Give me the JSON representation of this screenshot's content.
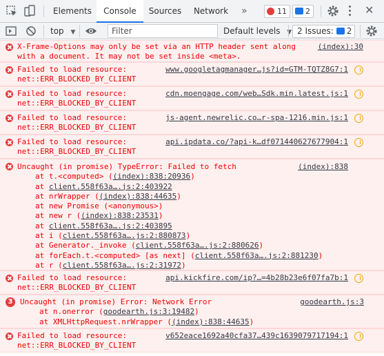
{
  "tabs": [
    {
      "label": "Elements"
    },
    {
      "label": "Console"
    },
    {
      "label": "Sources"
    },
    {
      "label": "Network"
    }
  ],
  "badges": {
    "errors": "11",
    "messages": "2"
  },
  "filterbar": {
    "context": "top",
    "filter_placeholder": "Filter",
    "levels": "Default levels",
    "issues_label": "2 Issues:",
    "issues_count": "2"
  },
  "colors": {
    "error_text": "#e00000",
    "error_bg": "#fff0f0",
    "accent": "#1a73e8",
    "warn": "#f0a500"
  },
  "messages": [
    {
      "lines": [
        "X-Frame-Options may only be set via an HTTP header sent along",
        "with a document. It may not be set inside <meta>."
      ],
      "source": "(index):30"
    },
    {
      "lines": [
        "Failed to load resource:",
        "net::ERR_BLOCKED_BY_CLIENT"
      ],
      "source": "www.googletagmanager…js?id=GTM-TQTZ8G7:1"
    },
    {
      "lines": [
        "Failed to load resource:",
        "net::ERR_BLOCKED_BY_CLIENT"
      ],
      "source": "cdn.moengage.com/web…Sdk.min.latest.js:1"
    },
    {
      "lines": [
        "Failed to load resource:",
        "net::ERR_BLOCKED_BY_CLIENT"
      ],
      "source": "js-agent.newrelic.co…r-spa-1216.min.js:1"
    },
    {
      "lines": [
        "Failed to load resource:",
        "net::ERR_BLOCKED_BY_CLIENT"
      ],
      "source": "api.ipdata.co/?api-k…df071440627677904:1"
    },
    {
      "head": "Uncaught (in promise) TypeError: Failed to fetch",
      "source": "(index):838",
      "stack": [
        {
          "pre": "at t.<computed> (",
          "link": "(index):838:20936",
          "post": ")"
        },
        {
          "pre": "at ",
          "link": "client.558f63a….js:2:403922",
          "post": ""
        },
        {
          "pre": "at nrWrapper (",
          "link": "(index):838:44635",
          "post": ")"
        },
        {
          "pre": "at new Promise (<anonymous>)",
          "link": "",
          "post": ""
        },
        {
          "pre": "at new r (",
          "link": "(index):838:23531",
          "post": ")"
        },
        {
          "pre": "at ",
          "link": "client.558f63a….js:2:403895",
          "post": ""
        },
        {
          "pre": "at i (",
          "link": "client.558f63a….js:2:880873",
          "post": ")"
        },
        {
          "pre": "at Generator._invoke (",
          "link": "client.558f63a….js:2:880626",
          "post": ")"
        },
        {
          "pre": "at forEach.t.<computed> [as next] (",
          "link": "client.558f63a….js:2:881230",
          "post": ")"
        },
        {
          "pre": "at r (",
          "link": "client.558f63a….js:2:31972",
          "post": ")"
        }
      ]
    },
    {
      "lines": [
        "Failed to load resource:",
        "net::ERR_BLOCKED_BY_CLIENT"
      ],
      "source": "api.kickfire.com/ip?…=4b28b23e6f07fa7b:1"
    },
    {
      "count": "3",
      "head": "Uncaught (in promise) Error: Network Error",
      "source": "goodearth.js:3",
      "stack": [
        {
          "pre": "at n.onerror (",
          "link": "goodearth.js:3:19482",
          "post": ")"
        },
        {
          "pre": "at XMLHttpRequest.nrWrapper (",
          "link": "(index):838:44635",
          "post": ")"
        }
      ]
    },
    {
      "lines": [
        "Failed to load resource:",
        "net::ERR_BLOCKED_BY_CLIENT"
      ],
      "source": "v652eace1692a40cfa37…439c1639079717194:1"
    }
  ]
}
